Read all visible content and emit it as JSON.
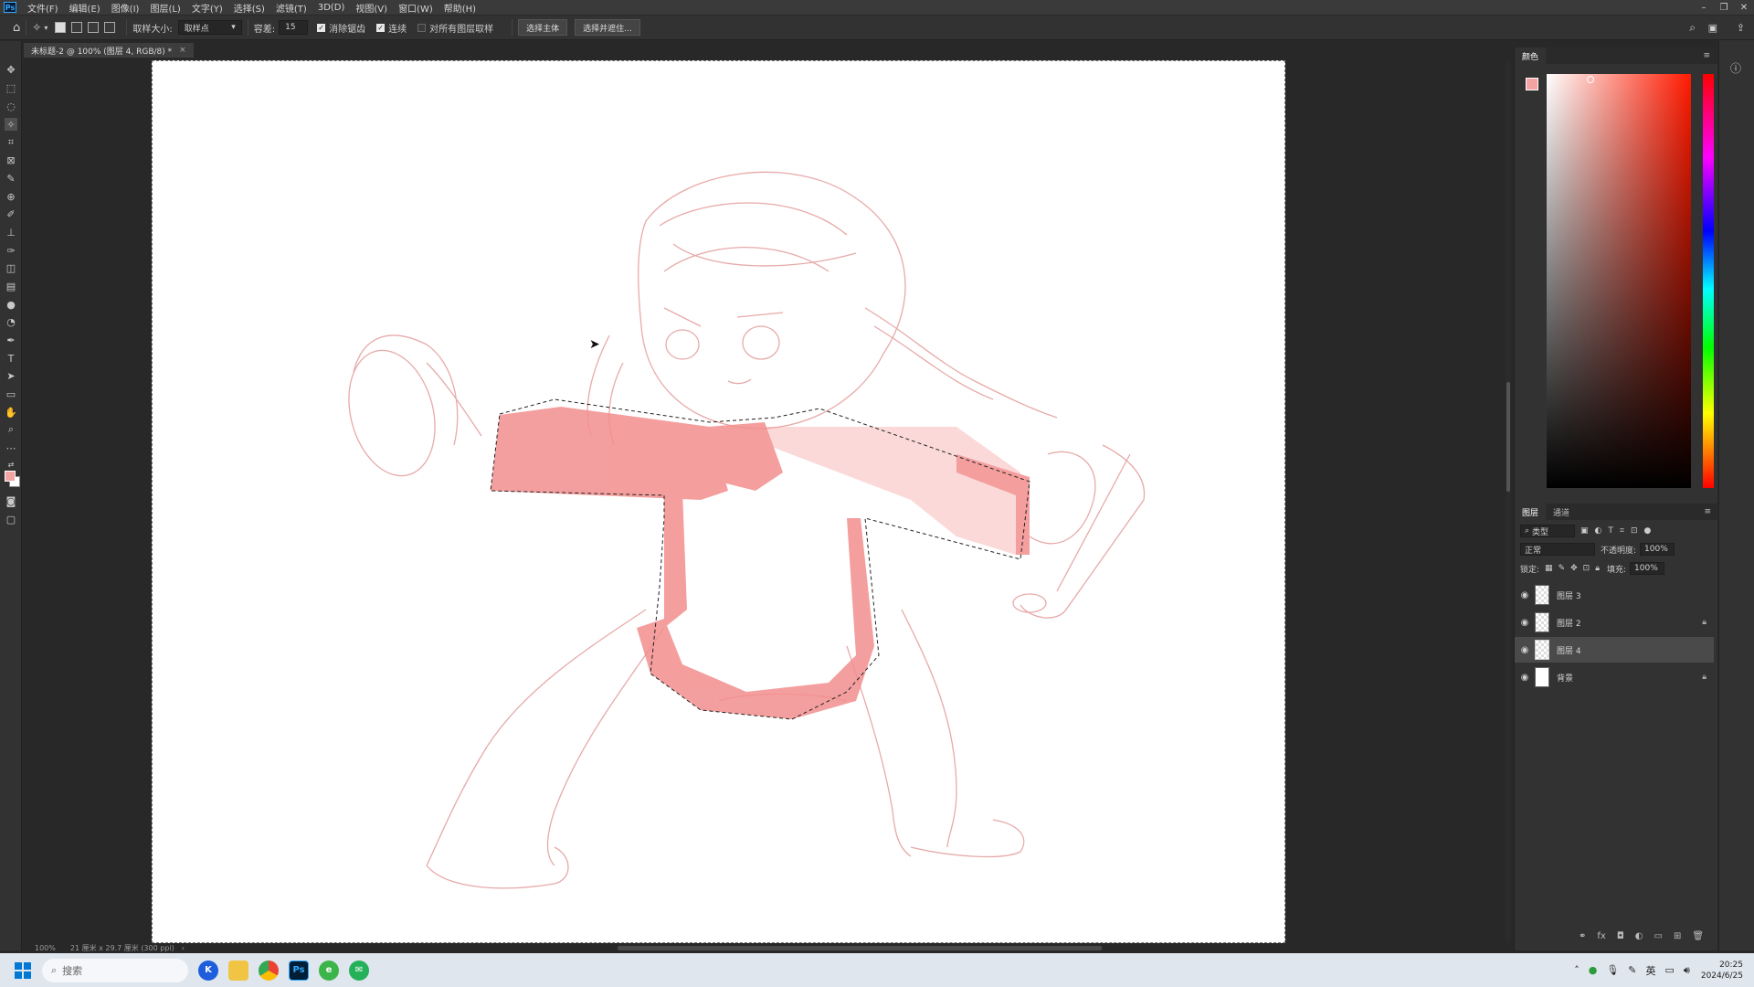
{
  "menubar": {
    "app_icon": "Ps",
    "items": [
      "文件(F)",
      "编辑(E)",
      "图像(I)",
      "图层(L)",
      "文字(Y)",
      "选择(S)",
      "滤镜(T)",
      "3D(D)",
      "视图(V)",
      "窗口(W)",
      "帮助(H)"
    ]
  },
  "options": {
    "sample_size_label": "取样大小:",
    "sample_size_value": "取样点",
    "tolerance_label": "容差:",
    "tolerance_value": "15",
    "antialias_label": "消除锯齿",
    "contiguous_label": "连续",
    "all_layers_label": "对所有图层取样",
    "select_subject_label": "选择主体",
    "select_mask_label": "选择并遮住..."
  },
  "document": {
    "tab_title": "未标题-2 @ 100% (图层 4, RGB/8) *"
  },
  "status": {
    "zoom": "100%",
    "doc_info": "21 厘米 x 29.7 厘米 (300 ppi)"
  },
  "color_panel": {
    "tabs": [
      "颜色"
    ],
    "fg_color": "#f4a3a3",
    "bg_color": "#ffffff"
  },
  "layers_panel": {
    "tabs": [
      "图层",
      "通道"
    ],
    "filter_label": "类型",
    "blend_mode": "正常",
    "opacity_label": "不透明度:",
    "opacity_value": "100%",
    "lock_label": "锁定:",
    "fill_label": "填充:",
    "fill_value": "100%",
    "layers": [
      {
        "name": "图层 3",
        "locked": false,
        "selected": false
      },
      {
        "name": "图层 2",
        "locked": true,
        "selected": false
      },
      {
        "name": "图层 4",
        "locked": false,
        "selected": true
      },
      {
        "name": "背景",
        "locked": true,
        "selected": false
      }
    ]
  },
  "taskbar": {
    "search_placeholder": "搜索",
    "time": "20:25",
    "date": "2024/6/25",
    "ime": "英"
  }
}
